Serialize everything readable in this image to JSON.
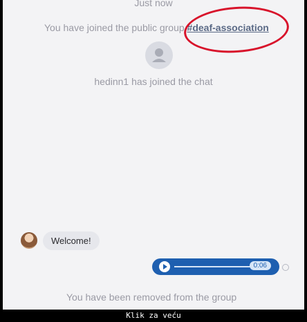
{
  "chat": {
    "timestamp": "Just now",
    "joined_group_prefix": "You have joined the public group",
    "group_tag": "#deaf-association",
    "user_joined": "hedinn1 has joined the chat",
    "welcome_message": "Welcome!",
    "audio_duration": "0:06",
    "removed_message": "You have been removed from the group"
  },
  "footer": {
    "caption": "Klik za veću"
  },
  "icons": {
    "group_avatar": "user-icon",
    "play": "play-icon"
  },
  "colors": {
    "highlight_circle": "#d8132b",
    "audio_bubble": "#1e5fb0"
  }
}
